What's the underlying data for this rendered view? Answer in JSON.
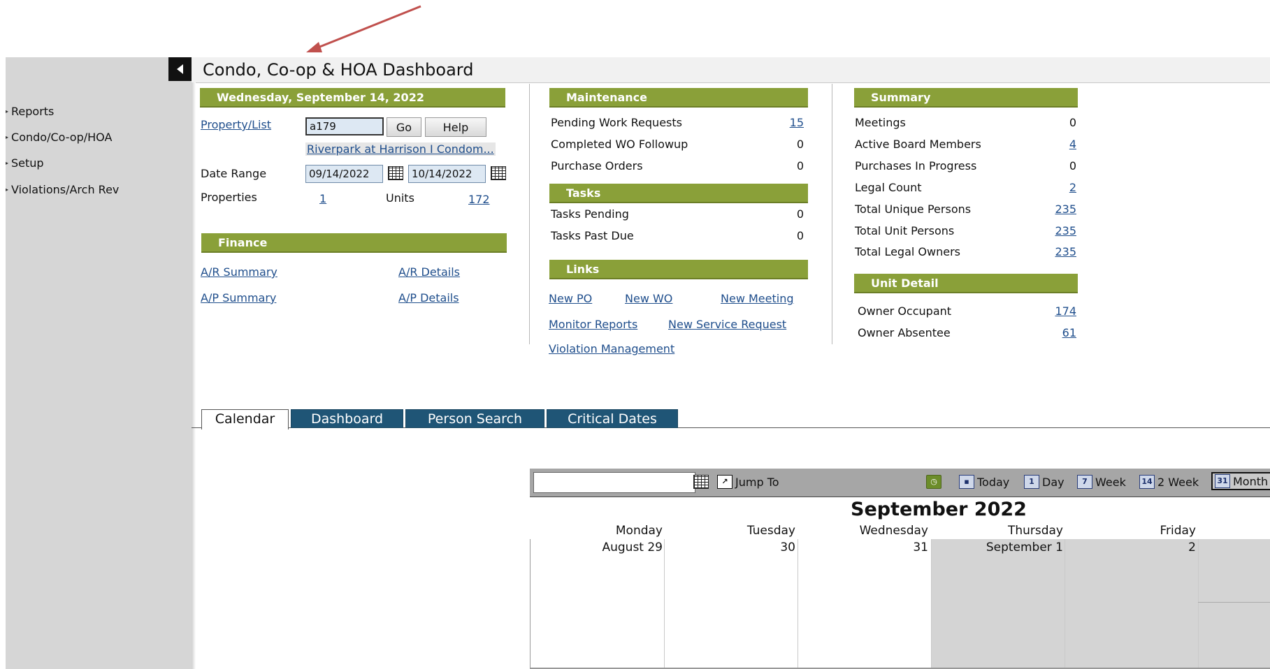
{
  "header": {
    "title": "Condo, Co-op & HOA Dashboard"
  },
  "sidebar": {
    "items": [
      {
        "label": "Reports"
      },
      {
        "label": "Condo/Co-op/HOA"
      },
      {
        "label": "Setup"
      },
      {
        "label": "Violations/Arch Rev"
      }
    ]
  },
  "property_panel": {
    "date_header": "Wednesday, September 14, 2022",
    "property_list_link": "Property/List",
    "property_code": "a179",
    "go_label": "Go",
    "help_label": "Help",
    "property_name": "Riverpark at Harrison I Condom...",
    "date_range_label": "Date Range",
    "date_from": "09/14/2022",
    "date_to": "10/14/2022",
    "properties_label": "Properties",
    "properties_value": "1",
    "units_label": "Units",
    "units_value": "172"
  },
  "finance": {
    "header": "Finance",
    "ar_summary": "A/R Summary",
    "ar_details": "A/R Details",
    "ap_summary": "A/P Summary",
    "ap_details": "A/P Details"
  },
  "maintenance": {
    "header": "Maintenance",
    "rows": [
      {
        "label": "Pending Work Requests",
        "value": "15",
        "link": true
      },
      {
        "label": "Completed WO Followup",
        "value": "0",
        "link": false
      },
      {
        "label": "Purchase Orders",
        "value": "0",
        "link": false
      }
    ]
  },
  "tasks": {
    "header": "Tasks",
    "rows": [
      {
        "label": "Tasks Pending",
        "value": "0"
      },
      {
        "label": "Tasks Past Due",
        "value": "0"
      }
    ]
  },
  "links": {
    "header": "Links",
    "new_po": "New PO",
    "new_wo": "New WO",
    "new_meeting": "New Meeting",
    "monitor_reports": "Monitor Reports",
    "new_service_request": "New Service Request",
    "violation_management": "Violation Management"
  },
  "summary": {
    "header": "Summary",
    "rows": [
      {
        "label": "Meetings",
        "value": "0",
        "link": false
      },
      {
        "label": "Active Board Members",
        "value": "4",
        "link": true
      },
      {
        "label": "Purchases In Progress",
        "value": "0",
        "link": false
      },
      {
        "label": "Legal Count",
        "value": "2",
        "link": true
      },
      {
        "label": "Total Unique Persons",
        "value": "235",
        "link": true
      },
      {
        "label": "Total Unit Persons",
        "value": "235",
        "link": true
      },
      {
        "label": "Total Legal Owners",
        "value": "235",
        "link": true
      }
    ]
  },
  "unit_detail": {
    "header": "Unit Detail",
    "rows": [
      {
        "label": "Owner Occupant",
        "value": "174"
      },
      {
        "label": "Owner Absentee",
        "value": "61"
      }
    ]
  },
  "tabs": [
    {
      "label": "Calendar",
      "active": true
    },
    {
      "label": "Dashboard",
      "active": false
    },
    {
      "label": "Person Search",
      "active": false
    },
    {
      "label": "Critical Dates",
      "active": false
    }
  ],
  "calendar": {
    "jump_to": "Jump To",
    "today": "Today",
    "day": "Day",
    "week": "Week",
    "two_week": "2 Week",
    "month": "Month",
    "title": "September 2022",
    "day_headers": [
      "Monday",
      "Tuesday",
      "Wednesday",
      "Thursday",
      "Friday"
    ],
    "day_numbers": [
      "August 29",
      "30",
      "31",
      "September 1",
      "2"
    ],
    "icons": {
      "day": "1",
      "week": "7",
      "two_week": "14",
      "month": "31"
    }
  },
  "colors": {
    "section_header": "#8aa039",
    "tab": "#1f5576",
    "link": "#1f4e8c",
    "annotation_arrow": "#c0504d"
  }
}
